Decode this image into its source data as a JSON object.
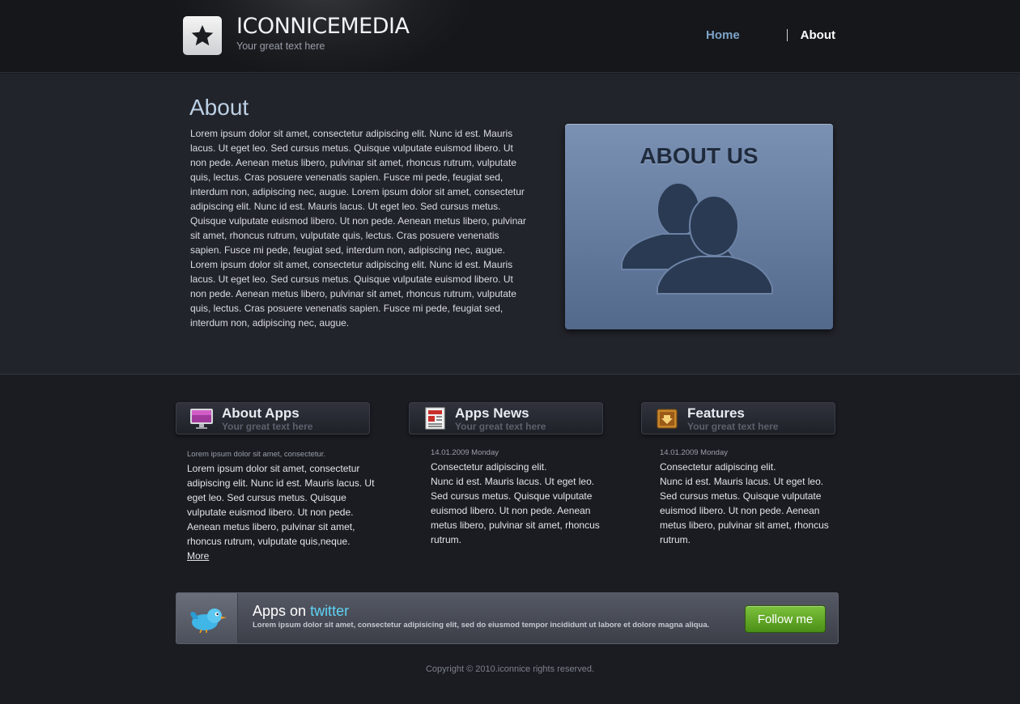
{
  "header": {
    "logo_title": "ICONNICEMEDIA",
    "logo_tagline": "Your great text here",
    "nav": [
      {
        "label": "Home"
      },
      {
        "label": "About"
      }
    ]
  },
  "about": {
    "title": "About",
    "paragraph_1": "Lorem ipsum dolor sit amet, consectetur adipiscing elit. Nunc id est. Mauris lacus. Ut eget leo. Sed cursus metus. Quisque vulputate euismod libero. Ut non pede. Aenean metus libero, pulvinar sit amet, rhoncus rutrum, vulputate quis, lectus. Cras posuere venenatis sapien. Fusce mi pede, feugiat sed, interdum non, adipiscing nec, augue. Lorem ipsum dolor sit amet, consectetur adipiscing elit. Nunc id est. Mauris lacus. Ut eget leo. Sed cursus metus. Quisque vulputate euismod libero. Ut non pede. Aenean metus libero, pulvinar sit amet, rhoncus rutrum, vulputate quis, lectus. Cras posuere venenatis sapien. Fusce mi pede, feugiat sed, interdum non, adipiscing nec, augue.",
    "paragraph_2": "Lorem ipsum dolor sit amet, consectetur adipiscing elit. Nunc id est. Mauris lacus. Ut eget leo. Sed cursus metus. Quisque vulputate euismod libero. Ut non pede. Aenean metus libero, pulvinar sit amet, rhoncus rutrum, vulputate quis, lectus. Cras posuere venenatis sapien. Fusce mi pede, feugiat sed, interdum non, adipiscing nec, augue.",
    "image_label": "ABOUT US"
  },
  "boxes": [
    {
      "title": "About Apps",
      "subtitle": "Your great text here",
      "icon": "monitor-icon",
      "meta": "Lorem ipsum dolor sit amet, consectetur.",
      "text": "Lorem ipsum dolor sit amet, consectetur adipiscing elit. Nunc id est. Mauris lacus. Ut eget leo. Sed cursus metus. Quisque vulputate euismod libero. Ut non pede. Aenean metus libero, pulvinar sit amet, rhoncus rutrum, vulputate quis,neque.",
      "link": "More"
    },
    {
      "title": "Apps News",
      "subtitle": "Your great text here",
      "icon": "newspaper-icon",
      "meta": "14.01.2009 Monday",
      "text_lead": "Consectetur adipiscing elit.",
      "text": "Nunc id est. Mauris lacus. Ut eget leo. Sed cursus metus. Quisque vulputate euismod libero. Ut non pede. Aenean metus libero, pulvinar sit amet, rhoncus rutrum."
    },
    {
      "title": "Features",
      "subtitle": "Your great text here",
      "icon": "box-download-icon",
      "meta": "14.01.2009 Monday",
      "text_lead": "Consectetur adipiscing elit.",
      "text": "Nunc id est. Mauris lacus. Ut eget leo. Sed cursus metus. Quisque vulputate euismod libero. Ut non pede. Aenean metus libero, pulvinar sit amet, rhoncus rutrum."
    }
  ],
  "twitter": {
    "title_prefix": "Apps on ",
    "title_brand": "twitter",
    "text": "Lorem ipsum dolor sit amet, consectetur adipisicing elit, sed do eiusmod tempor incididunt ut labore et dolore magna aliqua.",
    "button_label": "Follow me"
  },
  "footer": {
    "copyright": "Copyright © 2010.iconnice rights reserved."
  },
  "colors": {
    "background": "#1a1c22",
    "about_bg": "#22242b",
    "accent_blue": "#7da3c6",
    "twitter_blue": "#5fd3f5",
    "button_green": "#5ea626"
  }
}
